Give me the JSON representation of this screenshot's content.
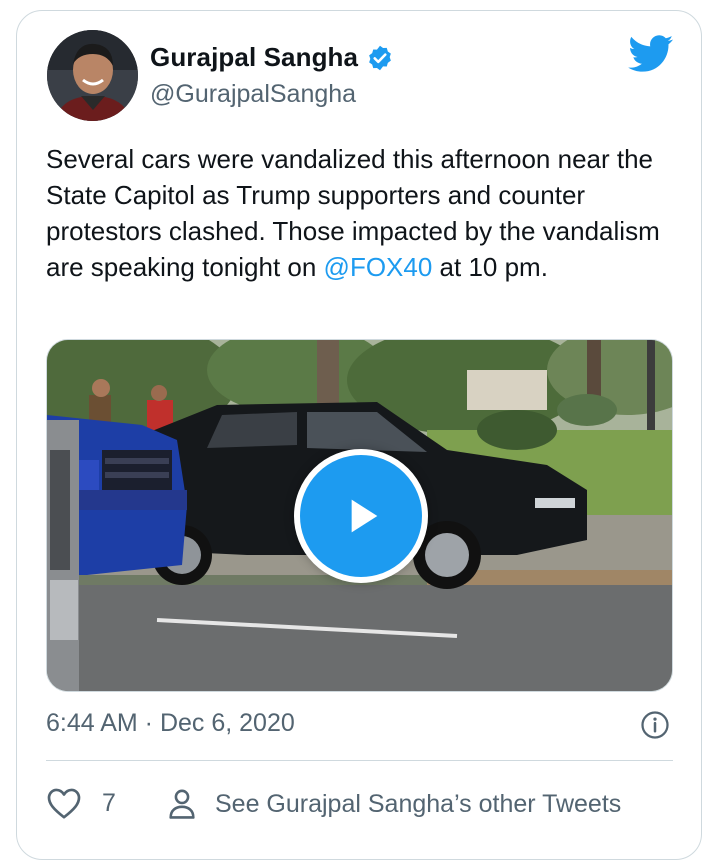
{
  "author": {
    "name": "Gurajpal Sangha",
    "handle": "@GurajpalSangha",
    "verified": true,
    "avatar_icon": "person-avatar"
  },
  "tweet": {
    "text_before": "Several cars were vandalized this afternoon near the State Capitol as Trump supporters and counter protestors clashed. Those impacted by the vandalism are speaking tonight on ",
    "mention": "@FOX40",
    "text_after": " at 10 pm."
  },
  "media": {
    "type": "video",
    "play_icon": "play-icon"
  },
  "meta": {
    "timestamp": "6:44 AM · Dec 6, 2020",
    "info_icon": "info-icon"
  },
  "actions": {
    "like_count": "7",
    "like_icon": "heart-icon",
    "see_more_label": "See Gurajpal Sangha’s other Tweets",
    "see_more_icon": "person-icon"
  },
  "brand": {
    "logo_icon": "twitter-bird-icon",
    "accent_color": "#1d9bf0",
    "text_secondary": "#536471"
  }
}
